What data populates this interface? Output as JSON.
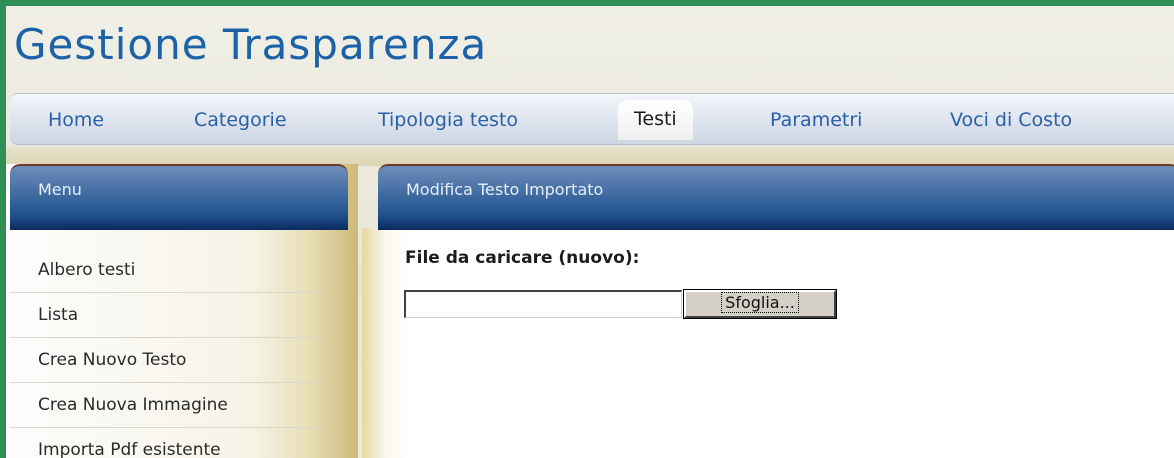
{
  "app": {
    "title": "Gestione Trasparenza"
  },
  "nav": {
    "items": [
      {
        "label": "Home"
      },
      {
        "label": "Categorie"
      },
      {
        "label": "Tipologia testo"
      },
      {
        "label": "Testi",
        "active": true
      },
      {
        "label": "Parametri"
      },
      {
        "label": "Voci di Costo"
      }
    ]
  },
  "sidebar": {
    "title": "Menu",
    "items": [
      {
        "label": "Albero testi"
      },
      {
        "label": "Lista"
      },
      {
        "label": "Crea Nuovo Testo"
      },
      {
        "label": "Crea Nuova Immagine"
      },
      {
        "label": "Importa Pdf esistente"
      }
    ]
  },
  "main": {
    "title": "Modifica Testo Importato",
    "file_label": "File da caricare (nuovo):",
    "file_value": "",
    "browse_label": "Sfoglia..."
  },
  "colors": {
    "frame": "#2f8f55",
    "title": "#1b62a7",
    "nav_text": "#2b5fa6",
    "panel_header": "#1f4f8a"
  }
}
